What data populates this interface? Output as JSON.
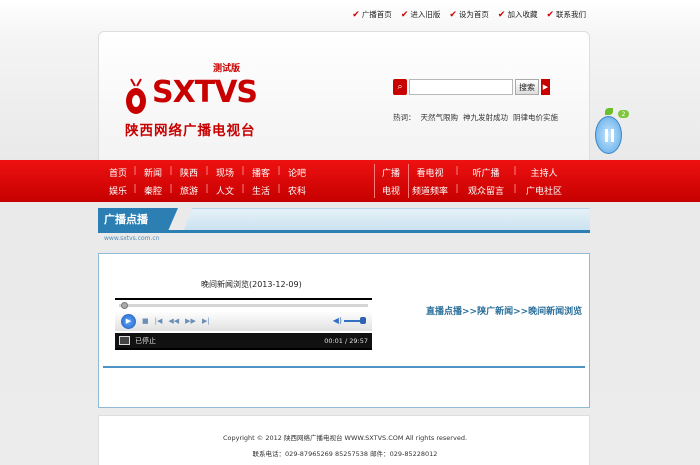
{
  "top_links": [
    {
      "label": "广播首页"
    },
    {
      "label": "进入旧版"
    },
    {
      "label": "设为首页"
    },
    {
      "label": "加入收藏"
    },
    {
      "label": "联系我们"
    }
  ],
  "logo": {
    "tag": "测试版",
    "name": "SXTVS",
    "name_cn": "陕西网络广播电视台"
  },
  "search": {
    "placeholder": "",
    "button_label": "搜索",
    "hot_label": "热词：",
    "hot_words": [
      "天然气限购",
      "神九发射成功",
      "阴律电价实施"
    ]
  },
  "nav": {
    "left_row1": [
      "首页",
      "新闻",
      "陕西",
      "现场",
      "播客",
      "论吧"
    ],
    "left_row2": [
      "娱乐",
      "秦腔",
      "旅游",
      "人文",
      "生活",
      "农科"
    ],
    "mid_row1": "广播",
    "mid_row2": "电视",
    "right_row1": [
      "看电视",
      "听广播",
      "主持人"
    ],
    "right_row2": [
      "频道频率",
      "观众留言",
      "广电社区"
    ]
  },
  "section": {
    "title": "广播点播",
    "url": "www.sxtvs.com.cn"
  },
  "content": {
    "video_title": "晚间新闻浏览(2013-12-09)",
    "breadcrumb": "直播点播>>陕广新闻>>晚间新闻浏览"
  },
  "player": {
    "status": "已停止",
    "time": "00:01 / 29:57"
  },
  "footer": {
    "copyright": "Copyright © 2012 陕西网络广播电视台 WWW.SXTVS.COM All rights reserved.",
    "contact": "联系电话：029-87965269 85257538 邮件：029-85228012"
  },
  "widget": {
    "badge": "2"
  },
  "colors": {
    "brand_red": "#c80000",
    "nav_red": "#e01010",
    "section_blue": "#2b7fb2"
  }
}
